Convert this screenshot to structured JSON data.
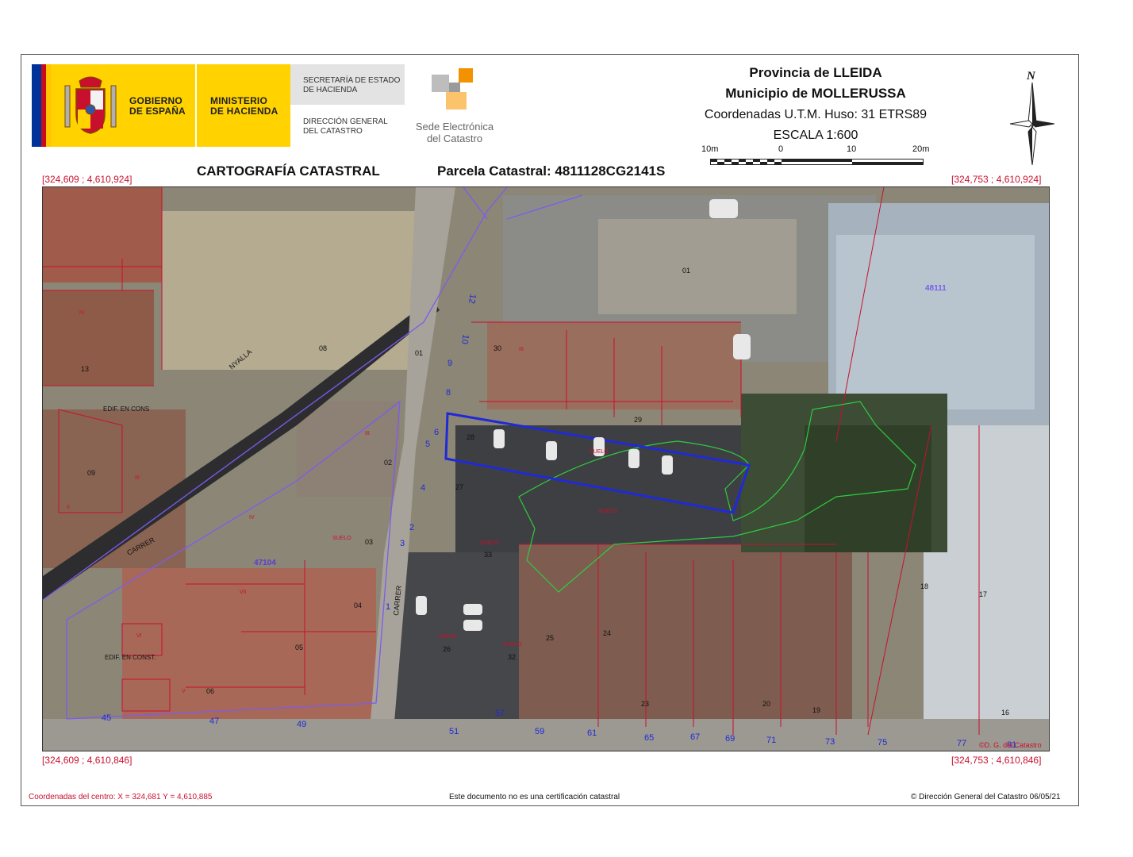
{
  "header": {
    "gov_line1": "GOBIERNO",
    "gov_line2": "DE ESPAÑA",
    "ministry_line1": "MINISTERIO",
    "ministry_line2": "DE HACIENDA",
    "secretariat_line1": "SECRETARÍA DE ESTADO",
    "secretariat_line2": "DE HACIENDA",
    "directorate_line1": "DIRECCIÓN GENERAL",
    "directorate_line2": "DEL CATASTRO",
    "sede_line1": "Sede Electrónica",
    "sede_line2": "del Catastro",
    "province": "Provincia de LLEIDA",
    "municipality": "Municipio de MOLLERUSSA",
    "coords_system": "Coordenadas U.T.M. Huso: 31 ETRS89",
    "scale": "ESCALA 1:600",
    "scale_ticks": [
      "10m",
      "0",
      "10",
      "20m"
    ],
    "north": "N"
  },
  "subtitle": {
    "left": "CARTOGRAFÍA CATASTRAL",
    "right": "Parcela Catastral: 4811128CG2141S"
  },
  "corners": {
    "top_left": "[324,609 ; 4,610,924]",
    "top_right": "[324,753 ; 4,610,924]",
    "bottom_left": "[324,609 ; 4,610,846]",
    "bottom_right": "[324,753 ; 4,610,846]"
  },
  "map_labels": {
    "blocks": [
      "48111",
      "47104"
    ],
    "parcels": [
      "01",
      "30",
      "29",
      "28",
      "27",
      "33",
      "02",
      "03",
      "04",
      "05",
      "06",
      "08",
      "09",
      "13",
      "24",
      "25",
      "26",
      "32",
      "23",
      "20",
      "19",
      "18",
      "17",
      "16",
      "01"
    ],
    "street_numbers": [
      "45",
      "47",
      "49",
      "51",
      "57",
      "59",
      "61",
      "65",
      "67",
      "69",
      "71",
      "73",
      "75",
      "77",
      "81"
    ],
    "side_numbers": [
      "12",
      "10",
      "9",
      "8",
      "6",
      "5",
      "4",
      "2",
      "3",
      "1"
    ],
    "edif": [
      "EDIF. EN CONS",
      "EDIF. EN CONST."
    ],
    "streets": [
      "CARRER",
      "CARRER",
      "NYALLA"
    ],
    "suelo": [
      "SUELO",
      "SUELO",
      "SUELO",
      "SUELO",
      "SUELO",
      "SUELO"
    ],
    "roman": [
      "III",
      "IV",
      "II",
      "III",
      "IV",
      "VII",
      "VI",
      "V",
      "III"
    ],
    "copyright": "©D. G. del Catastro"
  },
  "footer": {
    "center_coords": "Coordenadas del centro: X = 324,681 Y = 4,610,885",
    "disclaimer": "Este documento no es una certificación catastral",
    "copyright": "© Dirección General del Catastro 06/05/21"
  },
  "colors": {
    "red": "#c8102e",
    "parcel_blue": "#1f2ad6",
    "block_purple": "#7b5cf0",
    "vegetation_green": "#2ecc40",
    "gov_yellow": "#ffd200",
    "catastro_orange": "#f39200"
  },
  "icons": [
    "coat-of-arms-icon",
    "catastro-logo-icon",
    "north-arrow-icon"
  ]
}
